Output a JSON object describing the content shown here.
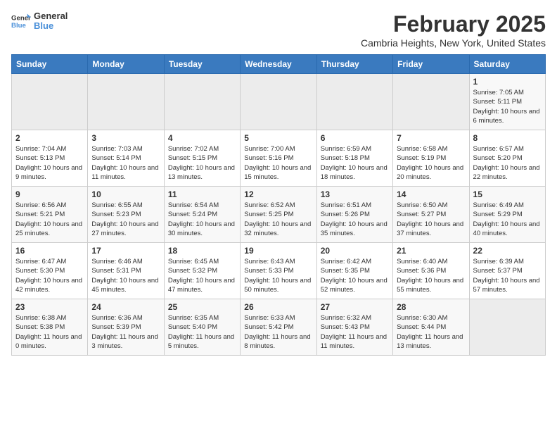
{
  "header": {
    "logo_line1": "General",
    "logo_line2": "Blue",
    "month": "February 2025",
    "location": "Cambria Heights, New York, United States"
  },
  "days_of_week": [
    "Sunday",
    "Monday",
    "Tuesday",
    "Wednesday",
    "Thursday",
    "Friday",
    "Saturday"
  ],
  "weeks": [
    [
      {
        "day": "",
        "info": ""
      },
      {
        "day": "",
        "info": ""
      },
      {
        "day": "",
        "info": ""
      },
      {
        "day": "",
        "info": ""
      },
      {
        "day": "",
        "info": ""
      },
      {
        "day": "",
        "info": ""
      },
      {
        "day": "1",
        "info": "Sunrise: 7:05 AM\nSunset: 5:11 PM\nDaylight: 10 hours and 6 minutes."
      }
    ],
    [
      {
        "day": "2",
        "info": "Sunrise: 7:04 AM\nSunset: 5:13 PM\nDaylight: 10 hours and 9 minutes."
      },
      {
        "day": "3",
        "info": "Sunrise: 7:03 AM\nSunset: 5:14 PM\nDaylight: 10 hours and 11 minutes."
      },
      {
        "day": "4",
        "info": "Sunrise: 7:02 AM\nSunset: 5:15 PM\nDaylight: 10 hours and 13 minutes."
      },
      {
        "day": "5",
        "info": "Sunrise: 7:00 AM\nSunset: 5:16 PM\nDaylight: 10 hours and 15 minutes."
      },
      {
        "day": "6",
        "info": "Sunrise: 6:59 AM\nSunset: 5:18 PM\nDaylight: 10 hours and 18 minutes."
      },
      {
        "day": "7",
        "info": "Sunrise: 6:58 AM\nSunset: 5:19 PM\nDaylight: 10 hours and 20 minutes."
      },
      {
        "day": "8",
        "info": "Sunrise: 6:57 AM\nSunset: 5:20 PM\nDaylight: 10 hours and 22 minutes."
      }
    ],
    [
      {
        "day": "9",
        "info": "Sunrise: 6:56 AM\nSunset: 5:21 PM\nDaylight: 10 hours and 25 minutes."
      },
      {
        "day": "10",
        "info": "Sunrise: 6:55 AM\nSunset: 5:23 PM\nDaylight: 10 hours and 27 minutes."
      },
      {
        "day": "11",
        "info": "Sunrise: 6:54 AM\nSunset: 5:24 PM\nDaylight: 10 hours and 30 minutes."
      },
      {
        "day": "12",
        "info": "Sunrise: 6:52 AM\nSunset: 5:25 PM\nDaylight: 10 hours and 32 minutes."
      },
      {
        "day": "13",
        "info": "Sunrise: 6:51 AM\nSunset: 5:26 PM\nDaylight: 10 hours and 35 minutes."
      },
      {
        "day": "14",
        "info": "Sunrise: 6:50 AM\nSunset: 5:27 PM\nDaylight: 10 hours and 37 minutes."
      },
      {
        "day": "15",
        "info": "Sunrise: 6:49 AM\nSunset: 5:29 PM\nDaylight: 10 hours and 40 minutes."
      }
    ],
    [
      {
        "day": "16",
        "info": "Sunrise: 6:47 AM\nSunset: 5:30 PM\nDaylight: 10 hours and 42 minutes."
      },
      {
        "day": "17",
        "info": "Sunrise: 6:46 AM\nSunset: 5:31 PM\nDaylight: 10 hours and 45 minutes."
      },
      {
        "day": "18",
        "info": "Sunrise: 6:45 AM\nSunset: 5:32 PM\nDaylight: 10 hours and 47 minutes."
      },
      {
        "day": "19",
        "info": "Sunrise: 6:43 AM\nSunset: 5:33 PM\nDaylight: 10 hours and 50 minutes."
      },
      {
        "day": "20",
        "info": "Sunrise: 6:42 AM\nSunset: 5:35 PM\nDaylight: 10 hours and 52 minutes."
      },
      {
        "day": "21",
        "info": "Sunrise: 6:40 AM\nSunset: 5:36 PM\nDaylight: 10 hours and 55 minutes."
      },
      {
        "day": "22",
        "info": "Sunrise: 6:39 AM\nSunset: 5:37 PM\nDaylight: 10 hours and 57 minutes."
      }
    ],
    [
      {
        "day": "23",
        "info": "Sunrise: 6:38 AM\nSunset: 5:38 PM\nDaylight: 11 hours and 0 minutes."
      },
      {
        "day": "24",
        "info": "Sunrise: 6:36 AM\nSunset: 5:39 PM\nDaylight: 11 hours and 3 minutes."
      },
      {
        "day": "25",
        "info": "Sunrise: 6:35 AM\nSunset: 5:40 PM\nDaylight: 11 hours and 5 minutes."
      },
      {
        "day": "26",
        "info": "Sunrise: 6:33 AM\nSunset: 5:42 PM\nDaylight: 11 hours and 8 minutes."
      },
      {
        "day": "27",
        "info": "Sunrise: 6:32 AM\nSunset: 5:43 PM\nDaylight: 11 hours and 11 minutes."
      },
      {
        "day": "28",
        "info": "Sunrise: 6:30 AM\nSunset: 5:44 PM\nDaylight: 11 hours and 13 minutes."
      },
      {
        "day": "",
        "info": ""
      }
    ]
  ]
}
